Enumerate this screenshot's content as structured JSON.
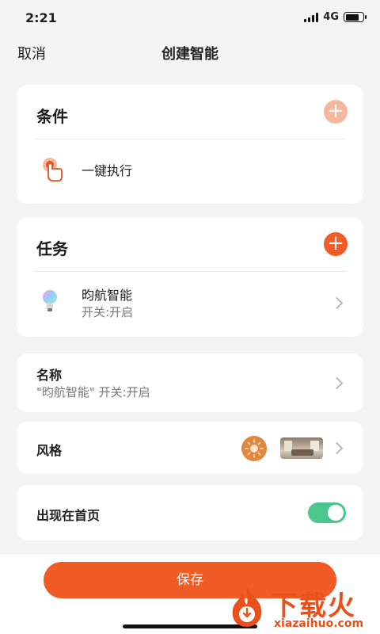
{
  "status": {
    "time": "2:21",
    "network": "4G"
  },
  "nav": {
    "cancel": "取消",
    "title": "创建智能"
  },
  "conditions": {
    "title": "条件",
    "item": "一键执行"
  },
  "tasks": {
    "title": "任务",
    "device_name": "昀航智能",
    "device_action": "开关:开启"
  },
  "name_row": {
    "label": "名称",
    "value": "\"昀航智能\" 开关:开启"
  },
  "style_row": {
    "label": "风格"
  },
  "homepage_row": {
    "label": "出现在首页",
    "enabled": true
  },
  "save_label": "保存",
  "watermark": {
    "brand": "下载火",
    "url": "xiazaihuo.com"
  },
  "colors": {
    "accent": "#f15b25",
    "accent_light": "#f5b89f",
    "toggle_on": "#4cc58f"
  }
}
